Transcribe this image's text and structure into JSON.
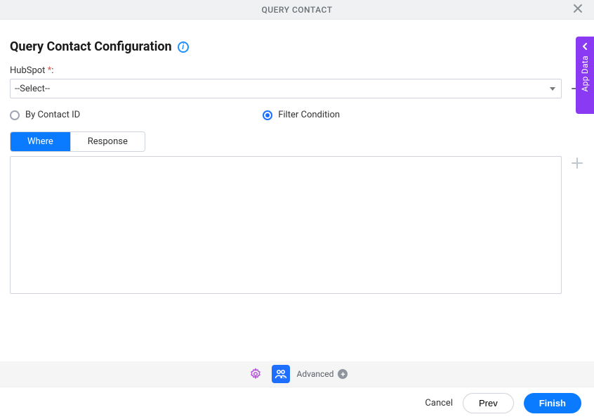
{
  "header": {
    "title": "QUERY CONTACT"
  },
  "page": {
    "title": "Query Contact Configuration"
  },
  "hubspot": {
    "label": "HubSpot ",
    "required_marker": "*",
    "label_suffix": ":",
    "selected": "--Select--"
  },
  "mode": {
    "options": {
      "byContactId": "By Contact ID",
      "filterCondition": "Filter Condition"
    },
    "selected": "filterCondition"
  },
  "tabs": {
    "where": "Where",
    "response": "Response",
    "active": "where"
  },
  "sideTab": {
    "label": "App Data"
  },
  "toolbar": {
    "advanced_label": "Advanced"
  },
  "footer": {
    "cancel": "Cancel",
    "prev": "Prev",
    "finish": "Finish"
  }
}
